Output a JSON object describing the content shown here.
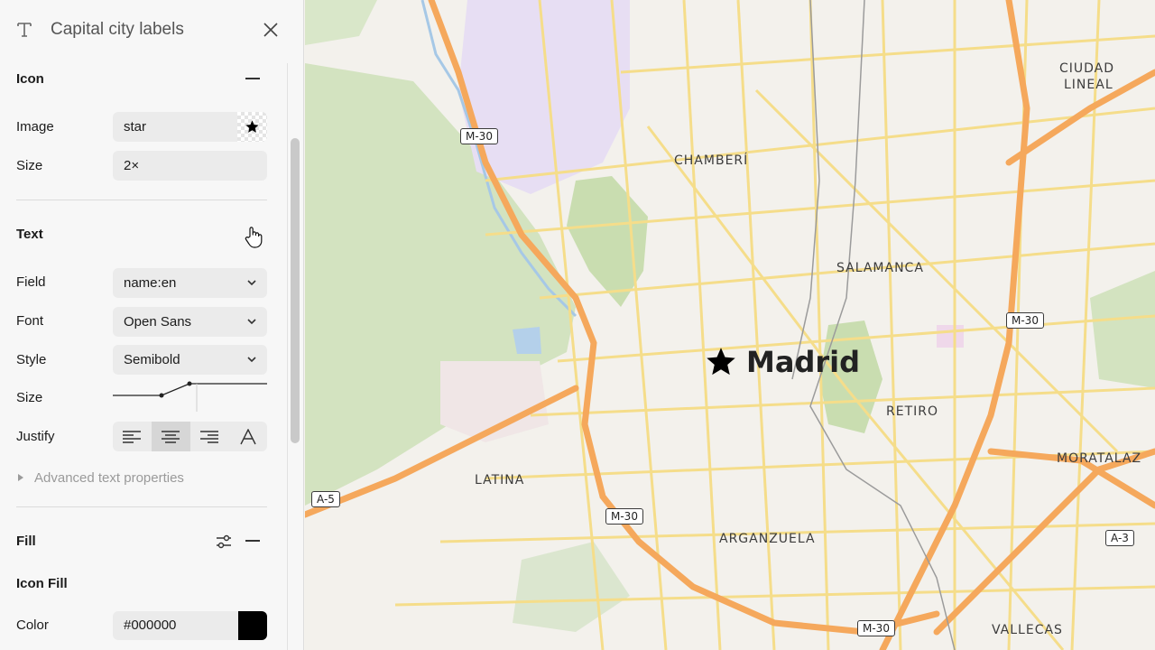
{
  "panel": {
    "title": "Capital city labels",
    "icon_section": {
      "title": "Icon",
      "image_label": "Image",
      "image_value": "star",
      "size_label": "Size",
      "size_value": "2×"
    },
    "text_section": {
      "title": "Text",
      "field_label": "Field",
      "field_value": "name:en",
      "font_label": "Font",
      "font_value": "Open Sans",
      "style_label": "Style",
      "style_value": "Semibold",
      "size_label": "Size",
      "justify_label": "Justify",
      "justify_selected": "center",
      "advanced": "Advanced text properties"
    },
    "fill_section": {
      "title": "Fill",
      "subtitle": "Icon Fill",
      "color_label": "Color",
      "color_value": "#000000"
    }
  },
  "map": {
    "city_label": "Madrid",
    "districts": [
      "CIUDAD",
      "LINEAL",
      "CHAMBERÍ",
      "SALAMANCA",
      "RETIRO",
      "LATINA",
      "ARGANZUELA",
      "MORATALAZ",
      "VALLECAS"
    ],
    "road_shields": [
      "M-30",
      "M-30",
      "M-30",
      "M-30",
      "A-5",
      "A-3"
    ]
  },
  "colors": {
    "accent": "#000000",
    "road": "#f7d774",
    "motorway": "#f5a85c",
    "park": "#d3e3c0",
    "residential": "#e7def3"
  }
}
